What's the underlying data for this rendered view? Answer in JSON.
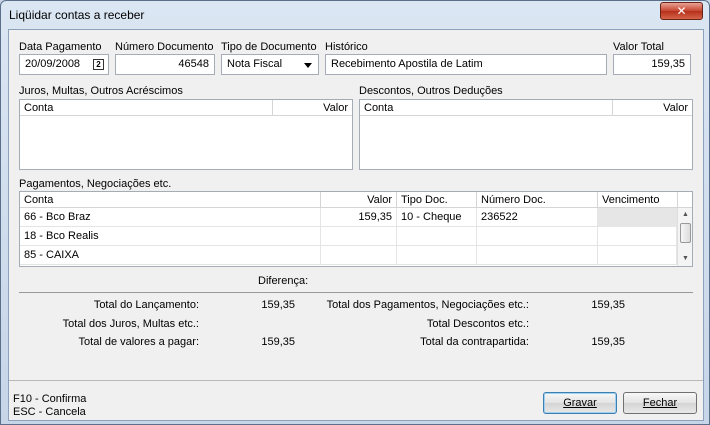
{
  "window": {
    "title": "Liqüidar contas a receber",
    "close_glyph": "✕"
  },
  "header": {
    "data_pagamento": {
      "label": "Data Pagamento",
      "value": "20/09/2008"
    },
    "numero_documento": {
      "label": "Número Documento",
      "value": "46548"
    },
    "tipo_documento": {
      "label": "Tipo de Documento",
      "value": "Nota Fiscal"
    },
    "historico": {
      "label": "Histórico",
      "value": "Recebimento Apostila de Latim"
    },
    "valor_total": {
      "label": "Valor Total",
      "value": "159,35"
    }
  },
  "juros": {
    "title": "Juros, Multas, Outros Acréscimos",
    "columns": [
      "Conta",
      "Valor"
    ]
  },
  "descontos": {
    "title": "Descontos, Outros Deduções",
    "columns": [
      "Conta",
      "Valor"
    ]
  },
  "pagamentos": {
    "title": "Pagamentos, Negociações etc.",
    "columns": [
      "Conta",
      "Valor",
      "Tipo Doc.",
      "Número Doc.",
      "Vencimento"
    ],
    "rows": [
      [
        "66 - Bco Braz",
        "159,35",
        "10 - Cheque",
        "236522",
        ""
      ],
      [
        "18 - Bco Realis",
        "",
        "",
        "",
        ""
      ],
      [
        "85 - CAIXA",
        "",
        "",
        "",
        ""
      ]
    ]
  },
  "totais": {
    "diferenca_label": "Diferença:",
    "total_lancamento": {
      "label": "Total do Lançamento:",
      "value": "159,35"
    },
    "total_juros": {
      "label": "Total dos Juros, Multas etc.:",
      "value": ""
    },
    "total_valores_pagar": {
      "label": "Total de valores a pagar:",
      "value": "159,35"
    },
    "total_pagamentos": {
      "label": "Total dos Pagamentos, Negociações etc.:",
      "value": "159,35"
    },
    "total_descontos": {
      "label": "Total Descontos etc.:",
      "value": ""
    },
    "total_contrapartida": {
      "label": "Total da contrapartida:",
      "value": "159,35"
    }
  },
  "footer": {
    "hint1": "F10 - Confirma",
    "hint2": "ESC - Cancela",
    "gravar_label": "Gravar",
    "fechar_label": "Fechar"
  }
}
